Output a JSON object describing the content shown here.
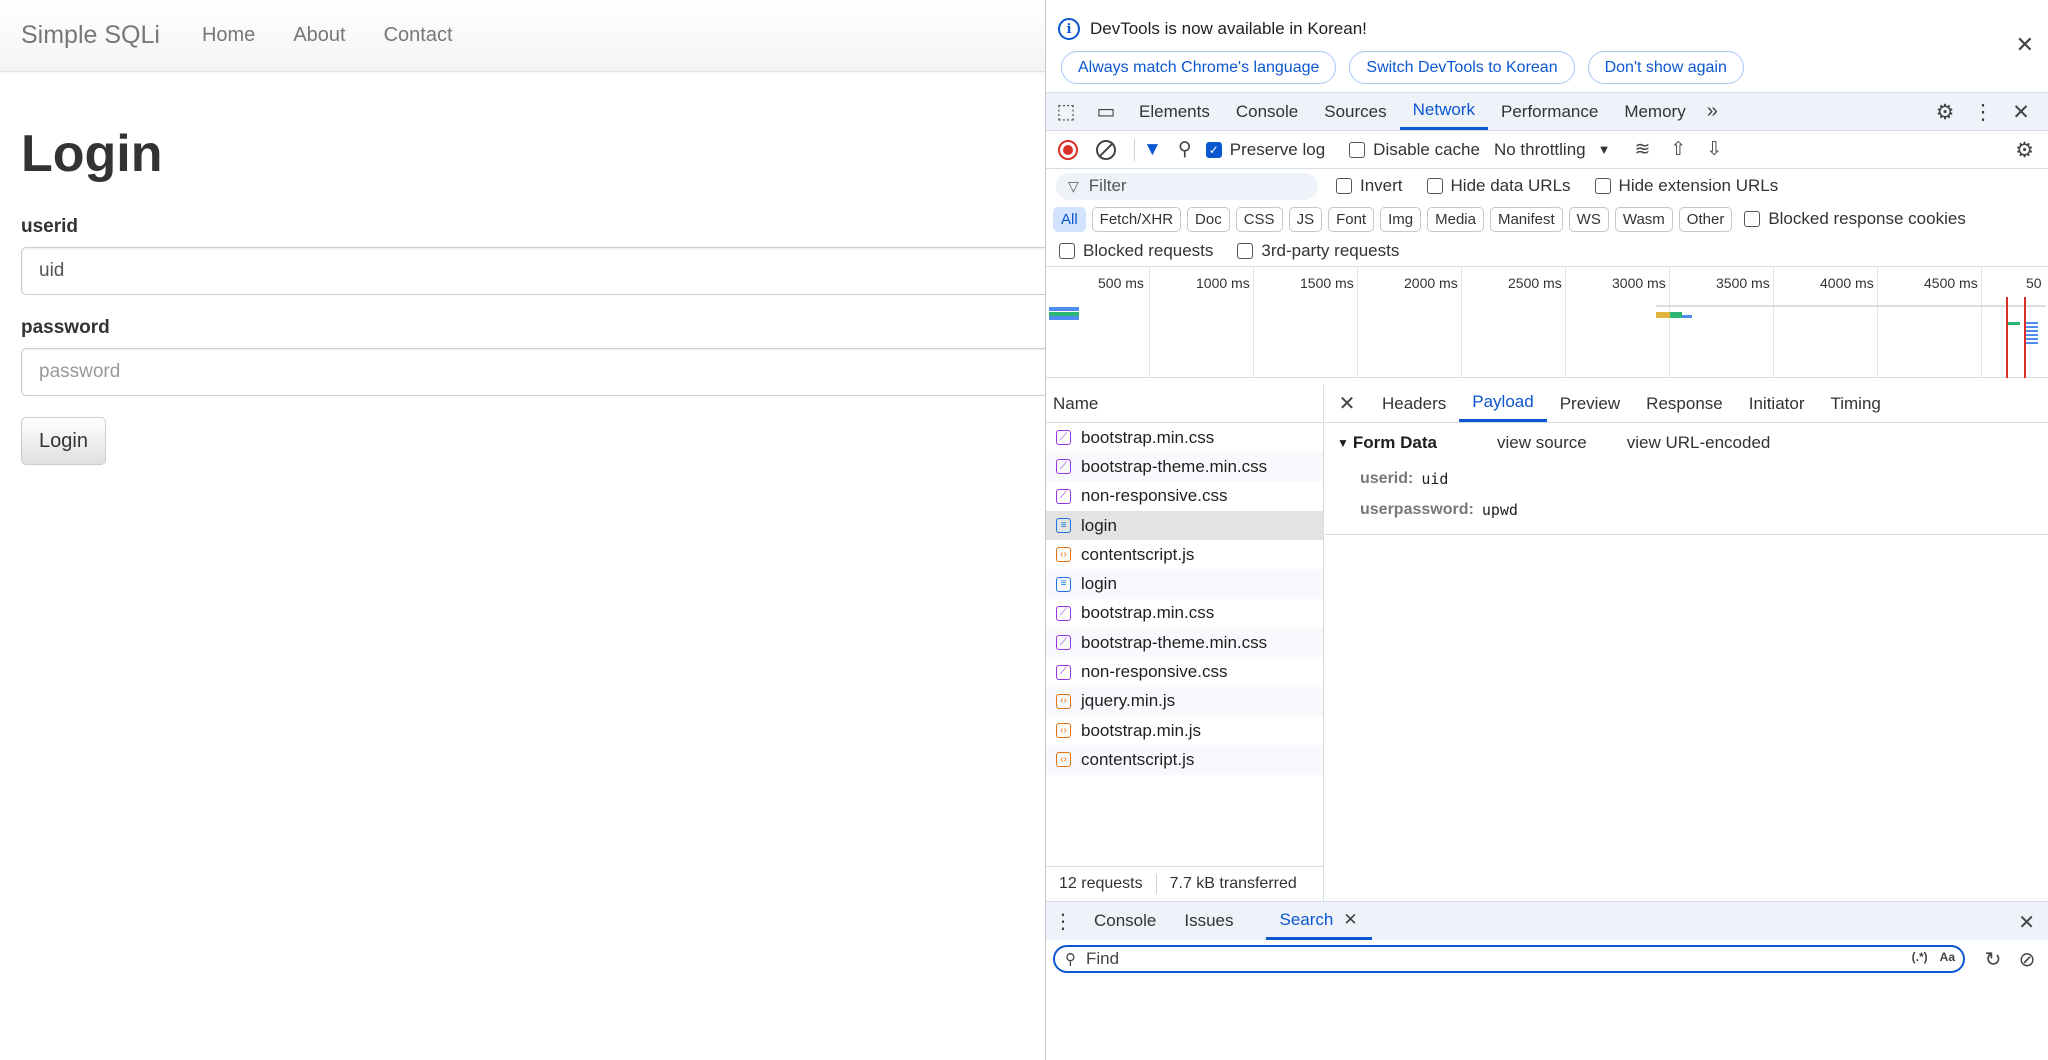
{
  "page": {
    "brand": "Simple SQLi",
    "nav": [
      "Home",
      "About",
      "Contact"
    ],
    "title": "Login",
    "userid_label": "userid",
    "userid_value": "uid",
    "password_label": "password",
    "password_placeholder": "password",
    "login_button": "Login"
  },
  "devtools": {
    "info": {
      "message": "DevTools is now available in Korean!",
      "buttons": [
        "Always match Chrome's language",
        "Switch DevTools to Korean",
        "Don't show again"
      ]
    },
    "tabs": [
      "Elements",
      "Console",
      "Sources",
      "Network",
      "Performance",
      "Memory"
    ],
    "active_tab": "Network",
    "toolbar": {
      "preserve_log": "Preserve log",
      "preserve_log_checked": true,
      "disable_cache": "Disable cache",
      "throttling": "No throttling"
    },
    "filter": {
      "placeholder": "Filter",
      "invert": "Invert",
      "hide_data_urls": "Hide data URLs",
      "hide_extension_urls": "Hide extension URLs"
    },
    "types": [
      "All",
      "Fetch/XHR",
      "Doc",
      "CSS",
      "JS",
      "Font",
      "Img",
      "Media",
      "Manifest",
      "WS",
      "Wasm",
      "Other"
    ],
    "active_type": "All",
    "blocked_response_cookies": "Blocked response cookies",
    "blocked_requests": "Blocked requests",
    "third_party_requests": "3rd-party requests",
    "timeline_ticks": [
      "500 ms",
      "1000 ms",
      "1500 ms",
      "2000 ms",
      "2500 ms",
      "3000 ms",
      "3500 ms",
      "4000 ms",
      "4500 ms",
      "50"
    ],
    "requests": {
      "header": "Name",
      "items": [
        {
          "name": "bootstrap.min.css",
          "type": "css"
        },
        {
          "name": "bootstrap-theme.min.css",
          "type": "css"
        },
        {
          "name": "non-responsive.css",
          "type": "css"
        },
        {
          "name": "login",
          "type": "doc",
          "selected": true
        },
        {
          "name": "contentscript.js",
          "type": "js"
        },
        {
          "name": "login",
          "type": "doc"
        },
        {
          "name": "bootstrap.min.css",
          "type": "css"
        },
        {
          "name": "bootstrap-theme.min.css",
          "type": "css"
        },
        {
          "name": "non-responsive.css",
          "type": "css"
        },
        {
          "name": "jquery.min.js",
          "type": "js"
        },
        {
          "name": "bootstrap.min.js",
          "type": "js"
        },
        {
          "name": "contentscript.js",
          "type": "js"
        }
      ],
      "count": "12 requests",
      "transferred": "7.7 kB transferred"
    },
    "detail": {
      "tabs": [
        "Headers",
        "Payload",
        "Preview",
        "Response",
        "Initiator",
        "Timing"
      ],
      "active_tab": "Payload",
      "form_title": "Form Data",
      "view_source": "view source",
      "view_url_encoded": "view URL-encoded",
      "fields": [
        {
          "key": "userid:",
          "value": "uid"
        },
        {
          "key": "userpassword:",
          "value": "upwd"
        }
      ]
    },
    "drawer": {
      "tabs": [
        "Console",
        "Issues",
        "Search"
      ],
      "active_tab": "Search",
      "find_placeholder": "Find",
      "regex": "(.*)",
      "match_case": "Aa"
    }
  }
}
